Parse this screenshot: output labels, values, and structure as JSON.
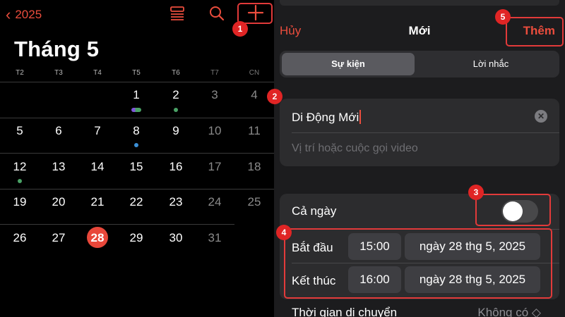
{
  "calendar": {
    "back_year": "2025",
    "month_title": "Tháng 5",
    "weekdays": [
      "T2",
      "T3",
      "T4",
      "T5",
      "T6",
      "T7",
      "CN"
    ],
    "weeks": [
      [
        "",
        "",
        "",
        "1",
        "2",
        "3",
        "4"
      ],
      [
        "5",
        "6",
        "7",
        "8",
        "9",
        "10",
        "11"
      ],
      [
        "12",
        "13",
        "14",
        "15",
        "16",
        "17",
        "18"
      ],
      [
        "19",
        "20",
        "21",
        "22",
        "23",
        "24",
        "25"
      ],
      [
        "26",
        "27",
        "28",
        "29",
        "30",
        "31",
        ""
      ]
    ],
    "today": "28",
    "icons": {
      "back": "chevron-left-icon",
      "list": "list-view-icon",
      "search": "search-icon",
      "add": "plus-icon"
    }
  },
  "sheet": {
    "cancel": "Hủy",
    "title": "Mới",
    "add": "Thêm",
    "segments": [
      "Sự kiện",
      "Lời nhắc"
    ],
    "event_title": "Di Động Mới",
    "location_placeholder": "Vị trí hoặc cuộc gọi video",
    "all_day_label": "Cả ngày",
    "all_day_on": false,
    "start_label": "Bắt đầu",
    "start_time": "15:00",
    "start_date": "ngày 28 thg 5, 2025",
    "end_label": "Kết thúc",
    "end_time": "16:00",
    "end_date": "ngày 28 thg 5, 2025",
    "travel_label": "Thời gian di chuyển",
    "travel_value": "Không có ◇"
  },
  "annotations": [
    "1",
    "2",
    "3",
    "4",
    "5"
  ],
  "colors": {
    "accent": "#eb4d3d",
    "annotation": "#e02525",
    "today": "#e8473a",
    "event_purple": "#7e55d8",
    "event_green": "#4aa266",
    "event_blue": "#3b8fd6"
  }
}
